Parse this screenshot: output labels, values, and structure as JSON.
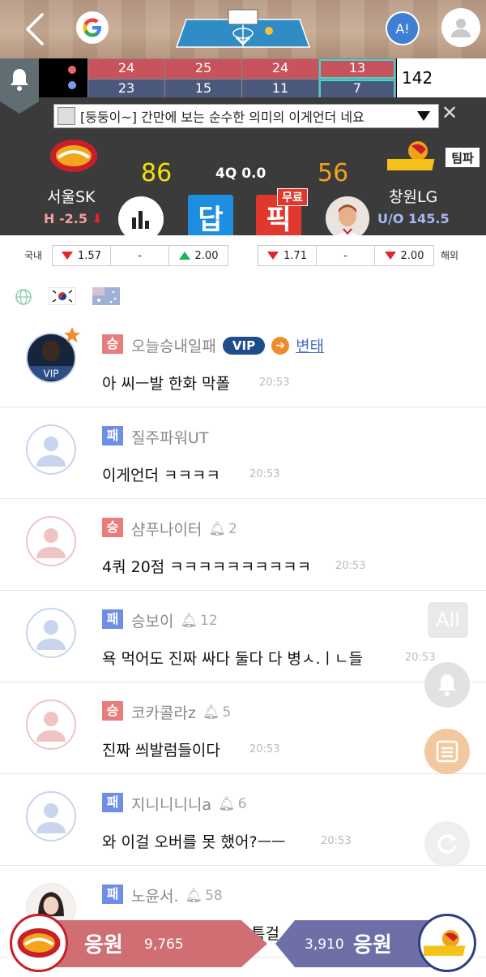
{
  "scoreboard": {
    "home_quarters": [
      "24",
      "25",
      "24",
      "13"
    ],
    "away_quarters": [
      "23",
      "15",
      "11",
      "7"
    ],
    "total": "142"
  },
  "ticker": {
    "text": "[둥둥이~] 간만에 보는 순수한 의미의 이게언더 네요"
  },
  "match": {
    "home_name": "서울SK",
    "home_handicap": "H -2.5",
    "home_score": "86",
    "away_name": "창원LG",
    "away_overunder": "U/O 145.5",
    "away_score": "56",
    "period": "4Q 0.0",
    "team_badge": "팀파",
    "dap_label": "답",
    "pick_label": "픽",
    "free_label": "무료",
    "colors": {
      "score": "#f5e10a",
      "away_score": "#f0a31c",
      "home_hcap": "#f0a0a0",
      "away_ou": "#a8b8f0"
    }
  },
  "odds": {
    "domestic_label": "국내",
    "overseas_label": "해외",
    "domestic": [
      "1.57",
      "-",
      "2.00"
    ],
    "overseas": [
      "1.71",
      "-",
      "2.00"
    ]
  },
  "chat": [
    {
      "result": "승",
      "nick": "오늘승내일패",
      "vip": "VIP",
      "rank": "변태",
      "msg": "아 씨ㅡ발 한화 막폴",
      "time": "20:53",
      "avatar": "vip-avatar",
      "bell": ""
    },
    {
      "result": "패",
      "nick": "질주파워UT",
      "msg": "이게언더 ㅋㅋㅋㅋ",
      "time": "20:53",
      "avatar": "default",
      "bell": ""
    },
    {
      "result": "승",
      "nick": "샴푸나이터",
      "msg": "4쿼 20점 ㅋㅋㅋㅋㅋㅋㅋㅋㅋㅋ",
      "time": "20:53",
      "avatar": "default",
      "bell": "2"
    },
    {
      "result": "패",
      "nick": "승보이",
      "msg": "욕 먹어도 진짜 싸다 둘다 다 병ㅅ.ㅣㄴ들",
      "time": "20:53",
      "avatar": "default",
      "bell": "12"
    },
    {
      "result": "승",
      "nick": "코카콜라z",
      "msg": "진짜 씌발럼들이다",
      "time": "20:53",
      "avatar": "default",
      "bell": "5"
    },
    {
      "result": "패",
      "nick": "지니니니니a",
      "msg": "와 이걸 오버를 못 했어?ㅡㅡ",
      "time": "20:53",
      "avatar": "default",
      "bell": "6"
    },
    {
      "result": "패",
      "nick": "노윤서.",
      "msg": "특걸",
      "time": "",
      "avatar": "photo",
      "bell": "58"
    }
  ],
  "side": {
    "all_label": "All"
  },
  "cheer": {
    "home_label": "응원",
    "home_count": "9,765",
    "away_label": "응원",
    "away_count": "3,910"
  }
}
